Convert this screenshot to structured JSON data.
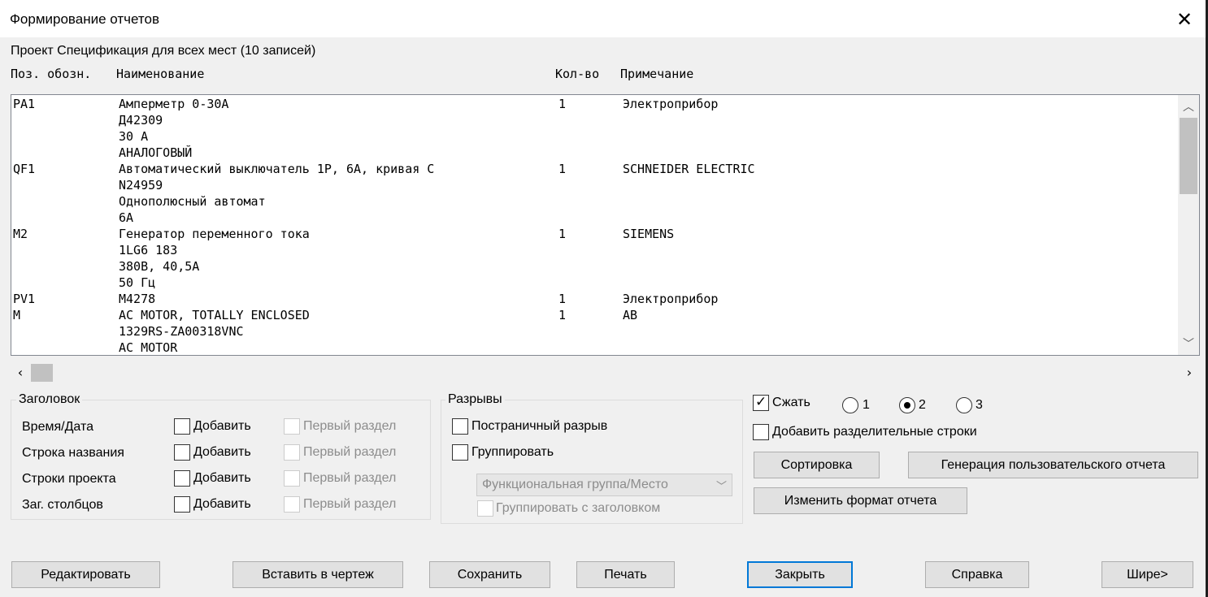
{
  "window": {
    "title": "Формирование отчетов",
    "close_icon": "close-icon"
  },
  "project_line": "Проект Спецификация для всех мест (10 записей)",
  "columns": {
    "pos": "Поз. обозн.",
    "name": "Наименование",
    "qty": "Кол-во",
    "note": "Примечание"
  },
  "rows": [
    {
      "pos": "PA1",
      "lines": [
        "Амперметр 0-30А",
        "Д42309",
        "30 А",
        "АНАЛОГОВЫЙ"
      ],
      "qty": "1",
      "note": "Электроприбор"
    },
    {
      "pos": "QF1",
      "lines": [
        "Автоматический выключатель 1P, 6A, кривая C",
        "N24959",
        "Однополюсный автомат",
        "6А"
      ],
      "qty": "1",
      "note": "SCHNEIDER ELECTRIC"
    },
    {
      "pos": "M2",
      "lines": [
        "Генератор переменного тока",
        "1LG6 183",
        "380В, 40,5А",
        "50 Гц"
      ],
      "qty": "1",
      "note": "SIEMENS"
    },
    {
      "pos": "PV1",
      "lines": [
        "М4278"
      ],
      "qty": "1",
      "note": "Электроприбор"
    },
    {
      "pos": "M",
      "lines": [
        "AC MOTOR, TOTALLY ENCLOSED",
        "1329RS-ZA00318VNC",
        "AC MOTOR"
      ],
      "qty": "1",
      "note": "AB"
    }
  ],
  "header_group": {
    "title": "Заголовок",
    "rows": [
      {
        "label": "Время/Дата",
        "add": "Добавить",
        "first": "Первый раздел"
      },
      {
        "label": "Строка названия",
        "add": "Добавить",
        "first": "Первый раздел"
      },
      {
        "label": "Строки проекта",
        "add": "Добавить",
        "first": "Первый раздел"
      },
      {
        "label": "Заг. столбцов",
        "add": "Добавить",
        "first": "Первый раздел"
      }
    ]
  },
  "breaks_group": {
    "title": "Разрывы",
    "page_break": "Постраничный разрыв",
    "group": "Группировать",
    "select_value": "Функциональная группа/Место",
    "group_with_header": "Группировать с заголовком"
  },
  "options": {
    "compress": "Сжать",
    "compress_checked": true,
    "radios": [
      "1",
      "2",
      "3"
    ],
    "radio_selected": "2",
    "add_separators": "Добавить разделительные строки"
  },
  "buttons": {
    "sort": "Сортировка",
    "custom": "Генерация пользовательского отчета",
    "format": "Изменить формат отчета",
    "edit": "Редактировать",
    "insert": "Вставить в чертеж",
    "save": "Сохранить",
    "print": "Печать",
    "close": "Закрыть",
    "help": "Справка",
    "wider": "Шире>"
  },
  "colors": {
    "default_button_border": "#0078d7",
    "title_bg": "#ffffff",
    "dialog_bg": "#f0f0f0"
  }
}
